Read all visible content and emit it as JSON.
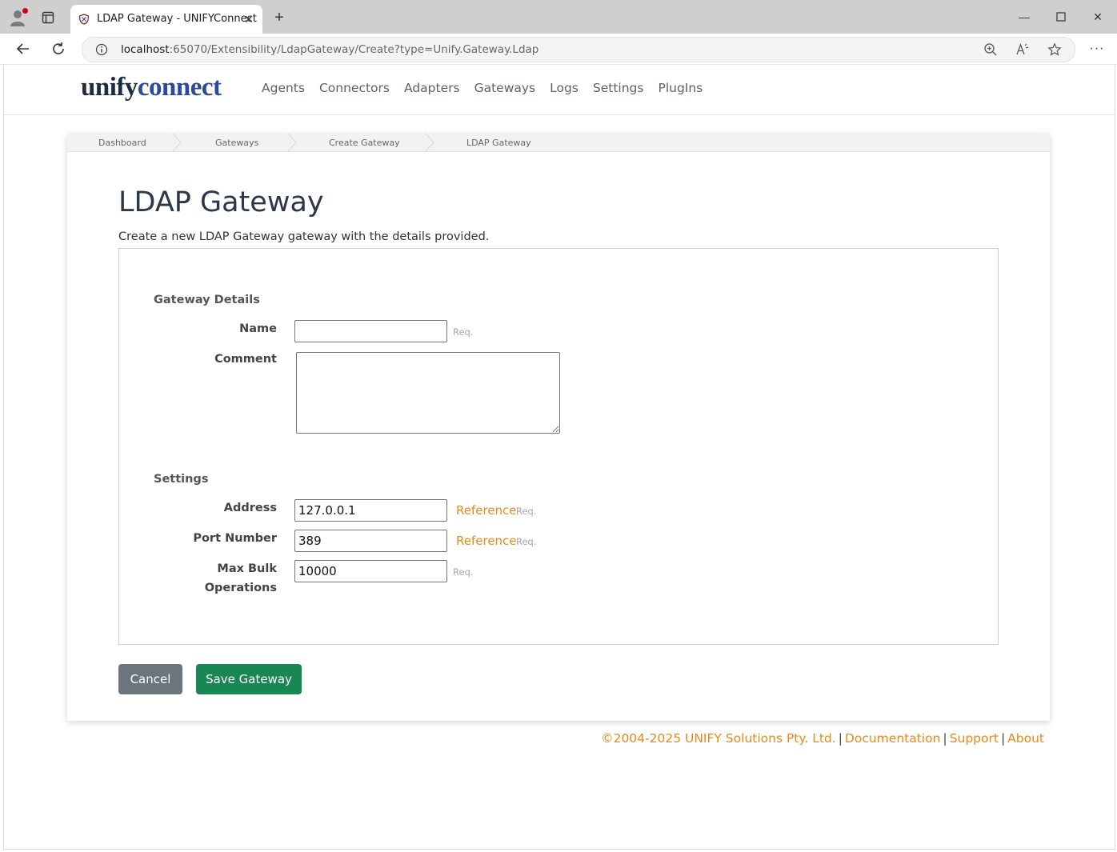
{
  "browser": {
    "tab_title": "LDAP Gateway - UNIFYConnect",
    "url_host": "localhost",
    "url_rest": ":65070/Extensibility/LdapGateway/Create?type=Unify.Gateway.Ldap"
  },
  "site": {
    "logo_part1": "unify",
    "logo_part2": "connect",
    "nav": [
      "Agents",
      "Connectors",
      "Adapters",
      "Gateways",
      "Logs",
      "Settings",
      "PlugIns"
    ]
  },
  "breadcrumb": [
    "Dashboard",
    "Gateways",
    "Create Gateway",
    "LDAP Gateway"
  ],
  "page": {
    "title": "LDAP Gateway",
    "description": "Create a new LDAP Gateway gateway with the details provided."
  },
  "form": {
    "section_details": "Gateway Details",
    "name_label": "Name",
    "name_value": "",
    "comment_label": "Comment",
    "comment_value": "",
    "section_settings": "Settings",
    "address_label": "Address",
    "address_value": "127.0.0.1",
    "port_label": "Port Number",
    "port_value": "389",
    "maxbulk_label_line1": "Max Bulk",
    "maxbulk_label_line2": "Operations",
    "maxbulk_value": "10000",
    "req_text": "Req.",
    "reference_text": "Reference"
  },
  "buttons": {
    "cancel": "Cancel",
    "save": "Save Gateway"
  },
  "footer": {
    "copyright": "©2004-2025 UNIFY Solutions Pty. Ltd.",
    "documentation": "Documentation",
    "support": "Support",
    "about": "About"
  },
  "colors": {
    "accent_orange": "#e8891b",
    "save_green": "#198754",
    "cancel_gray": "#6c757d"
  }
}
